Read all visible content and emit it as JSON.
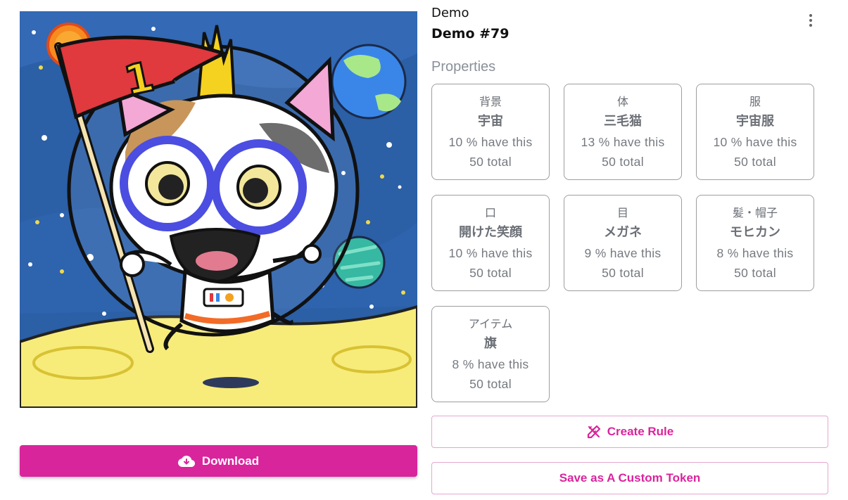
{
  "token": {
    "collection": "Demo",
    "name": "Demo #79"
  },
  "artwork": {
    "flag_number": "1",
    "palette": {
      "space": "#2b5fa6",
      "moon": "#f7ec7a",
      "flag": "#e0393e",
      "glasses": "#4b4ee0",
      "planet_blue": "#3a86e8",
      "planet_teal": "#36b8a2",
      "sun": "#f78b1f"
    }
  },
  "properties": {
    "title": "Properties",
    "items": [
      {
        "type": "背景",
        "value": "宇宙",
        "percent": "10 % have this",
        "total": "50 total"
      },
      {
        "type": "体",
        "value": "三毛猫",
        "percent": "13 % have this",
        "total": "50 total"
      },
      {
        "type": "服",
        "value": "宇宙服",
        "percent": "10 % have this",
        "total": "50 total"
      },
      {
        "type": "口",
        "value": "開けた笑顔",
        "percent": "10 % have this",
        "total": "50 total"
      },
      {
        "type": "目",
        "value": "メガネ",
        "percent": "9 % have this",
        "total": "50 total"
      },
      {
        "type": "髪・帽子",
        "value": "モヒカン",
        "percent": "8 % have this",
        "total": "50 total"
      },
      {
        "type": "アイテム",
        "value": "旗",
        "percent": "8 % have this",
        "total": "50 total"
      }
    ]
  },
  "actions": {
    "download_label": "Download",
    "create_rule_label": "Create Rule",
    "save_custom_label": "Save as A Custom Token",
    "accent_color": "#d9259c"
  },
  "icons": {
    "menu": "more-vertical-icon",
    "download": "cloud-download-icon",
    "create_rule": "pencil-ruler-icon"
  }
}
